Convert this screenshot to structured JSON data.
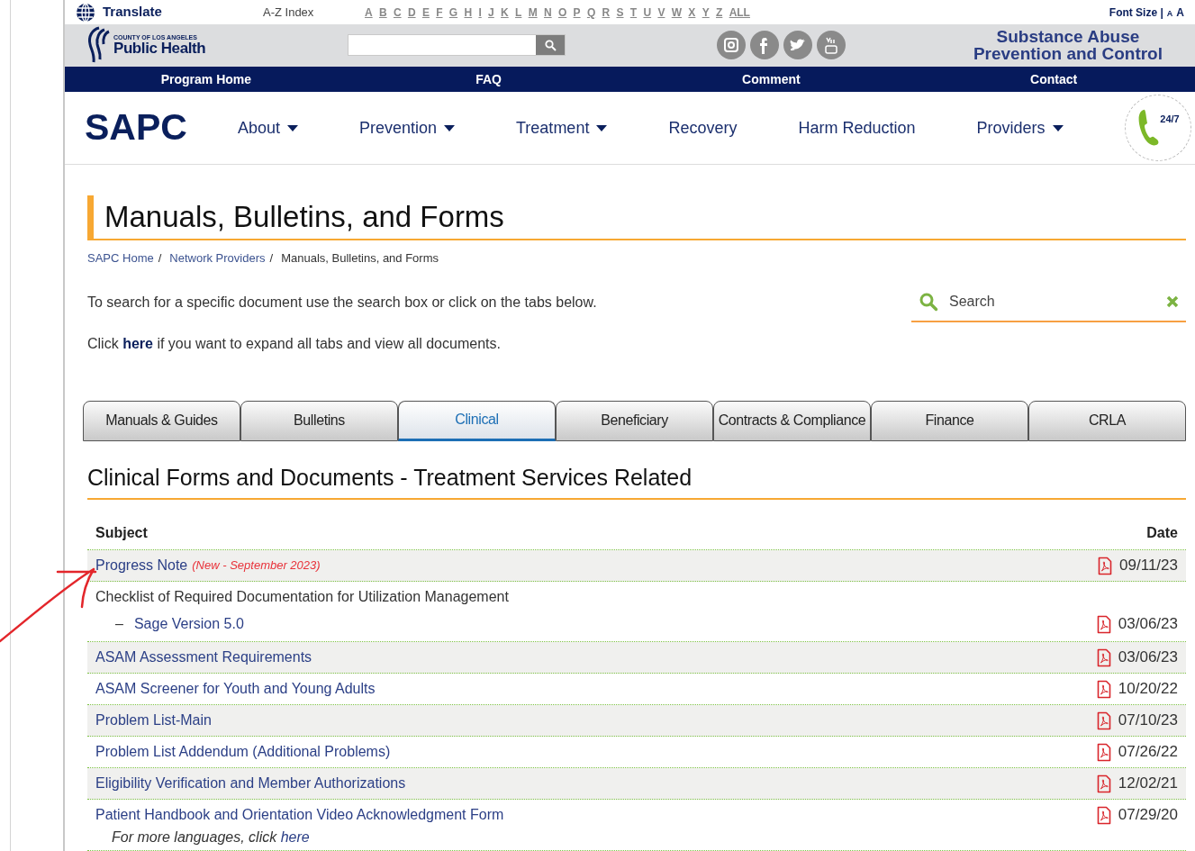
{
  "top_bar": {
    "translate": "Translate",
    "az_label": "A-Z Index",
    "letters": [
      "A",
      "B",
      "C",
      "D",
      "E",
      "F",
      "G",
      "H",
      "I",
      "J",
      "K",
      "L",
      "M",
      "N",
      "O",
      "P",
      "Q",
      "R",
      "S",
      "T",
      "U",
      "V",
      "W",
      "X",
      "Y",
      "Z",
      "ALL"
    ],
    "font_size": {
      "label": "Font Size |",
      "small": "A",
      "large": "A"
    }
  },
  "header": {
    "logo": {
      "small": "COUNTY OF LOS ANGELES",
      "main": "Public Health"
    },
    "program_name": [
      "Substance Abuse",
      "Prevention and Control"
    ]
  },
  "program_nav": [
    "Program Home",
    "FAQ",
    "Comment",
    "Contact"
  ],
  "main_nav": {
    "brand": "SAPC",
    "items": [
      {
        "label": "About",
        "dropdown": true
      },
      {
        "label": "Prevention",
        "dropdown": true
      },
      {
        "label": "Treatment",
        "dropdown": true
      },
      {
        "label": "Recovery",
        "dropdown": false
      },
      {
        "label": "Harm Reduction",
        "dropdown": false
      },
      {
        "label": "Providers",
        "dropdown": true
      }
    ],
    "hotline_badge": "24/7"
  },
  "page_title": "Manuals, Bulletins, and Forms",
  "breadcrumbs": [
    {
      "kind": "link",
      "label": "SAPC Home"
    },
    {
      "kind": "separator",
      "label": "/"
    },
    {
      "kind": "link",
      "label": "Network Providers"
    },
    {
      "kind": "separator",
      "label": "/"
    },
    {
      "kind": "current",
      "label": "Manuals, Bulletins, and Forms"
    }
  ],
  "intro": {
    "text": "To search for a specific document use the search box or click on the tabs below.",
    "expand": {
      "before": "Click",
      "link": "here",
      "after": "if you want to expand all tabs and view all documents."
    }
  },
  "search": {
    "placeholder": "Search"
  },
  "tabs": [
    {
      "label": "Manuals & Guides",
      "selected": false
    },
    {
      "label": "Bulletins",
      "selected": false
    },
    {
      "label": "Clinical",
      "selected": true
    },
    {
      "label": "Beneficiary",
      "selected": false
    },
    {
      "label": "Contracts & Compliance",
      "selected": false
    },
    {
      "label": "Finance",
      "selected": false
    },
    {
      "label": "CRLA",
      "selected": false
    }
  ],
  "section_title": "Clinical Forms and Documents - Treatment Services Related",
  "table": {
    "columns": [
      "Subject",
      "Date"
    ],
    "rows": [
      {
        "subject": "Progress Note",
        "kind": "link",
        "note": "(New - September 2023)",
        "date": "09/11/23"
      },
      {
        "subject": "Checklist of Required Documentation for Utilization Management",
        "kind": "text",
        "children": [
          {
            "bullet": "–",
            "label": "Sage Version 5.0",
            "date": "03/06/23"
          }
        ]
      },
      {
        "subject": "ASAM Assessment Requirements",
        "kind": "link",
        "date": "03/06/23"
      },
      {
        "subject": "ASAM Screener for Youth and Young Adults",
        "kind": "link",
        "date": "10/20/22"
      },
      {
        "subject": "Problem List-Main",
        "kind": "link",
        "date": "07/10/23"
      },
      {
        "subject": "Problem List Addendum (Additional Problems)",
        "kind": "link",
        "date": "07/26/22"
      },
      {
        "subject": "Eligibility Verification and Member Authorizations",
        "kind": "link",
        "date": "12/02/21"
      },
      {
        "subject": "Patient Handbook and Orientation Video Acknowledgment Form",
        "kind": "link",
        "date": "07/29/20",
        "extra": {
          "before": "For more languages, click",
          "link": "here"
        }
      }
    ]
  }
}
